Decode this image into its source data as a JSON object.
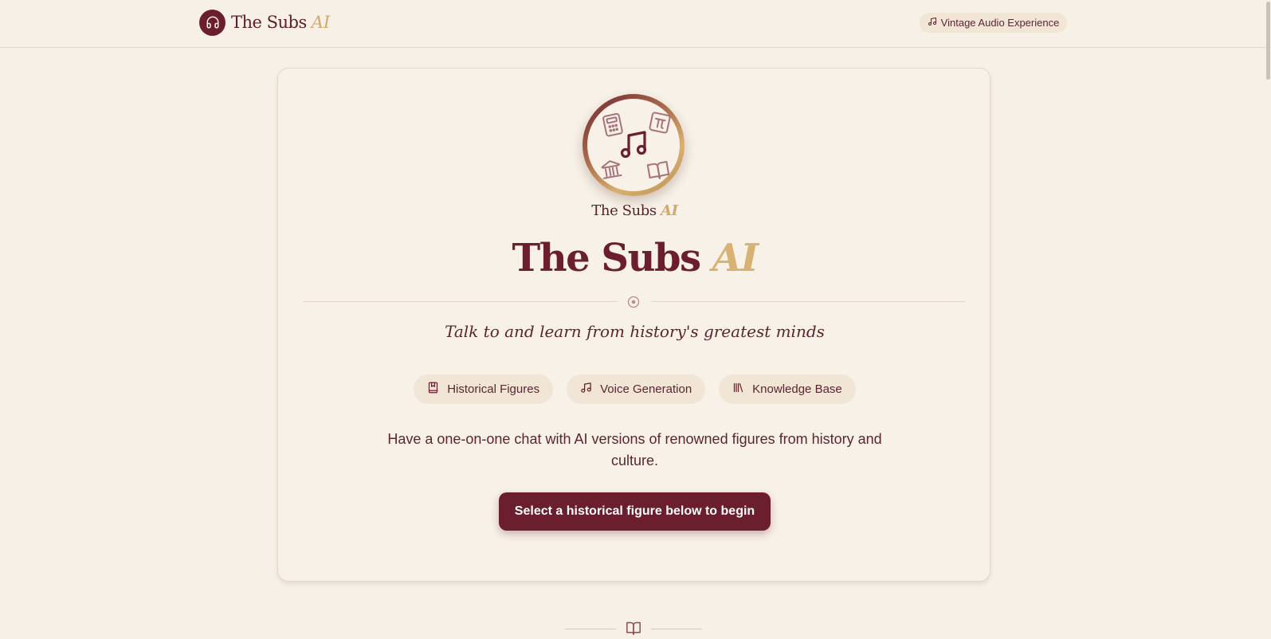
{
  "header": {
    "brand_name": "The Subs",
    "brand_ai": "AI",
    "badge_icon": "headphones-icon",
    "vintage_label": "Vintage Audio Experience",
    "vintage_icon": "music-note-icon"
  },
  "hero": {
    "emblem_icons": [
      "music-notes-icon",
      "calculator-icon",
      "pi-icon",
      "museum-icon",
      "book-icon"
    ],
    "emblem_caption_name": "The Subs",
    "emblem_caption_ai": "AI",
    "title_name": "The Subs",
    "title_ai": "AI",
    "divider_icon": "target-icon",
    "tagline": "Talk to and learn from history's greatest minds",
    "chips": [
      {
        "label": "Historical Figures",
        "icon": "bookmark-book-icon"
      },
      {
        "label": "Voice Generation",
        "icon": "music-note-icon"
      },
      {
        "label": "Knowledge Base",
        "icon": "library-icon"
      }
    ],
    "description": "Have a one-on-one chat with AI versions of renowned figures from history and culture.",
    "cta_label": "Select a historical figure below to begin"
  },
  "footer": {
    "ornament_icon": "open-book-icon"
  },
  "colors": {
    "background": "#f6f0e6",
    "primary": "#6b1e2e",
    "accent_gold": "#d2a96b",
    "chip_bg": "#f1e5d6"
  }
}
